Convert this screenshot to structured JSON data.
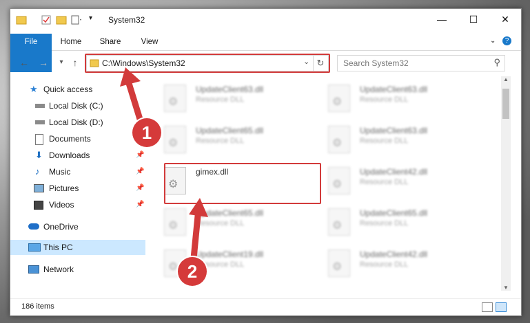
{
  "window": {
    "title": "System32"
  },
  "controls": {
    "minimize": "—",
    "maximize": "☐",
    "close": "✕"
  },
  "ribbon": {
    "tabs": [
      "File",
      "Home",
      "Share",
      "View"
    ],
    "help": "?"
  },
  "address": {
    "path": "C:\\Windows\\System32"
  },
  "search": {
    "placeholder": "Search System32"
  },
  "nav": {
    "items": [
      {
        "label": "Quick access",
        "icon": "star-icon"
      },
      {
        "label": "Local Disk (C:)",
        "icon": "drive-icon"
      },
      {
        "label": "Local Disk (D:)",
        "icon": "drive-icon"
      },
      {
        "label": "Documents",
        "icon": "documents-icon"
      },
      {
        "label": "Downloads",
        "icon": "download-icon"
      },
      {
        "label": "Music",
        "icon": "music-icon"
      },
      {
        "label": "Pictures",
        "icon": "pictures-icon"
      },
      {
        "label": "Videos",
        "icon": "videos-icon"
      },
      {
        "label": "OneDrive",
        "icon": "cloud-icon"
      },
      {
        "label": "This PC",
        "icon": "computer-icon"
      },
      {
        "label": "Network",
        "icon": "network-icon"
      }
    ]
  },
  "files": [
    {
      "name": "UpdateClient63.dll",
      "type": "Resource DLL"
    },
    {
      "name": "UpdateClient63.dll",
      "type": "Resource DLL"
    },
    {
      "name": "UpdateClient65.dll",
      "type": "Resource DLL"
    },
    {
      "name": "UpdateClient63.dll",
      "type": "Resource DLL"
    },
    {
      "name": "gimex.dll",
      "type": ""
    },
    {
      "name": "UpdateClient42.dll",
      "type": "Resource DLL"
    },
    {
      "name": "UpdateClient65.dll",
      "type": "Resource DLL"
    },
    {
      "name": "UpdateClient65.dll",
      "type": "Resource DLL"
    },
    {
      "name": "UpdateClient19.dll",
      "type": "Resource DLL"
    },
    {
      "name": "UpdateClient42.dll",
      "type": "Resource DLL"
    }
  ],
  "status": {
    "count": "186 items"
  },
  "annotations": {
    "step1": "1",
    "step2": "2",
    "color": "#d23a3a"
  }
}
